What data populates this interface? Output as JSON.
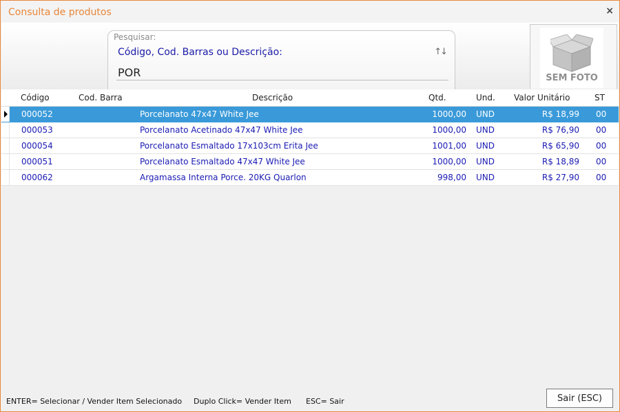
{
  "window": {
    "title": "Consulta de produtos",
    "close_label": "×"
  },
  "search": {
    "caption": "Pesquisar:",
    "hint": "Código, Cod. Barras ou Descrição:",
    "value": "POR",
    "sort_icon": "↑↓"
  },
  "photo": {
    "label": "SEM FOTO",
    "icon": "box-icon"
  },
  "grid": {
    "columns": [
      "Código",
      "Cod. Barra",
      "Descrição",
      "Qtd.",
      "Und.",
      "Valor Unitário",
      "ST"
    ],
    "rows": [
      {
        "codigo": "000052",
        "barra": "",
        "descricao": "Porcelanato 47x47 White Jee",
        "qtd": "1000,00",
        "und": "UND",
        "valor": "R$ 18,99",
        "st": "00"
      },
      {
        "codigo": "000053",
        "barra": "",
        "descricao": "Porcelanato Acetinado 47x47 White Jee",
        "qtd": "1000,00",
        "und": "UND",
        "valor": "R$ 76,90",
        "st": "00"
      },
      {
        "codigo": "000054",
        "barra": "",
        "descricao": "Porcelanato Esmaltado 17x103cm Erita Jee",
        "qtd": "1001,00",
        "und": "UND",
        "valor": "R$ 65,90",
        "st": "00"
      },
      {
        "codigo": "000051",
        "barra": "",
        "descricao": "Porcelanato Esmaltado 47x47 White Jee",
        "qtd": "1000,00",
        "und": "UND",
        "valor": "R$ 18,89",
        "st": "00"
      },
      {
        "codigo": "000062",
        "barra": "",
        "descricao": "Argamassa Interna Porce. 20KG Quarlon",
        "qtd": "998,00",
        "und": "UND",
        "valor": "R$ 27,90",
        "st": "00"
      }
    ],
    "selected_index": 0
  },
  "footer": {
    "help_enter": "ENTER= Selecionar / Vender Item Selecionado",
    "help_double": "Duplo Click= Vender Item",
    "help_esc": "ESC= Sair",
    "exit_label": "Sair (ESC)"
  },
  "colors": {
    "accent": "#e8863a",
    "selection": "#3a9ad9",
    "text_blue": "#1a1ab4"
  }
}
